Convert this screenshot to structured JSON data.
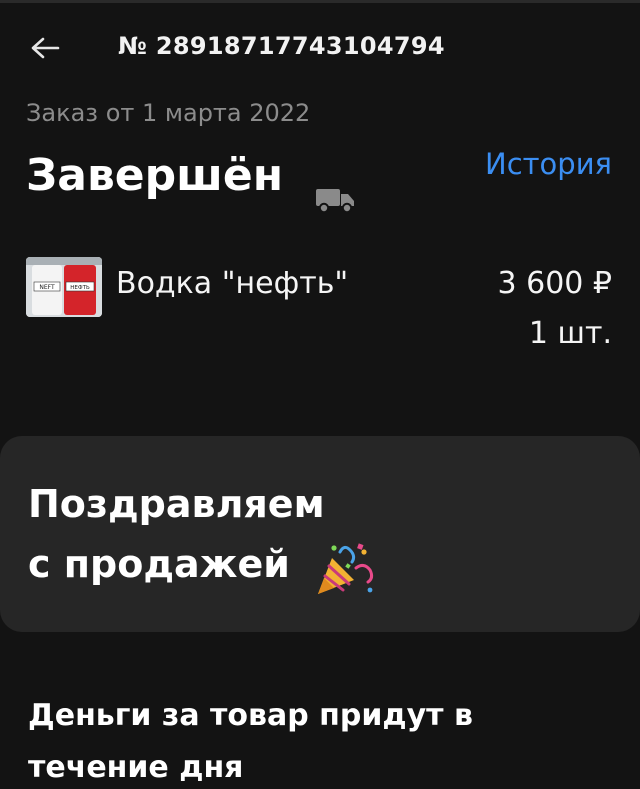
{
  "header": {
    "order_number": "№ 28918717743104794"
  },
  "order": {
    "date_label": "Заказ от 1 марта 2022",
    "status": "Завершён",
    "history_label": "История"
  },
  "product": {
    "name": "Водка \"нефть\"",
    "price": "3 600 ₽",
    "quantity": "1 шт.",
    "thumb_labels": [
      "NEFT",
      "НЕФТЬ"
    ]
  },
  "congrats": {
    "line1": "Поздравляем",
    "line2": "с продажей"
  },
  "money_notice": "Деньги за товар придут в течение дня",
  "icons": {
    "back": "arrow-left-icon",
    "delivery": "truck-icon",
    "celebration": "party-popper-icon"
  },
  "colors": {
    "background": "#131313",
    "card": "#262626",
    "accent_link": "#3b8ef2",
    "muted_text": "#8c8c8c"
  }
}
